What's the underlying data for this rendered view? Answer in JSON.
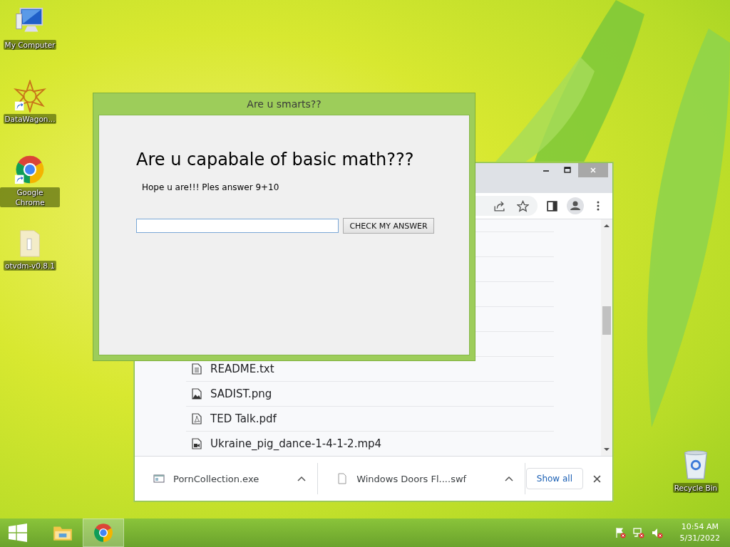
{
  "desktop_icons": [
    {
      "label": "My Computer",
      "kind": "computer",
      "shortcut": false
    },
    {
      "label": "DataWagon...",
      "kind": "star",
      "shortcut": true
    },
    {
      "label": "Google Chrome",
      "kind": "chrome",
      "shortcut": true
    },
    {
      "label": "otvdm-v0.8.1",
      "kind": "folder",
      "shortcut": false
    }
  ],
  "recycle_bin": {
    "label": "Recycle Bin"
  },
  "browser": {
    "files": [
      {
        "name": "README.txt",
        "kind": "text"
      },
      {
        "name": "SADIST.png",
        "kind": "image"
      },
      {
        "name": "TED Talk.pdf",
        "kind": "pdf"
      },
      {
        "name": "Ukraine_pig_dance-1-4-1-2.mp4",
        "kind": "video"
      }
    ],
    "downloads": [
      {
        "name": "PornCollection.exe",
        "kind": "program"
      },
      {
        "name": "Windows Doors Fl....swf",
        "kind": "file"
      }
    ],
    "show_all": "Show all"
  },
  "dialog": {
    "title": "Are u smarts??",
    "heading": "Are u capabale of basic math???",
    "prompt": "Hope u are!!! Ples answer 9+10",
    "button": "CHECK MY ANSWER"
  },
  "taskbar": {
    "apps": [
      {
        "kind": "explorer",
        "selected": false
      },
      {
        "kind": "chrome",
        "selected": true
      }
    ],
    "time": "10:54 AM",
    "date": "5/31/2022"
  }
}
